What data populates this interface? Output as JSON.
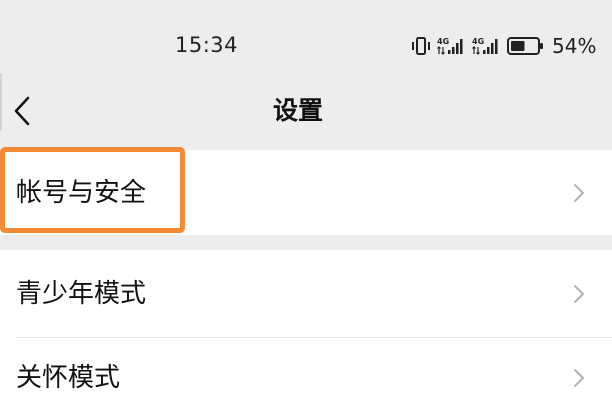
{
  "status_bar": {
    "time": "15:34",
    "network": [
      {
        "label": "4G"
      },
      {
        "label": "4G"
      }
    ],
    "battery": {
      "label": "54%",
      "level": 0.54
    }
  },
  "nav": {
    "title": "设置"
  },
  "settings": {
    "groups": [
      {
        "items": [
          {
            "label": "帐号与安全"
          }
        ]
      },
      {
        "items": [
          {
            "label": "青少年模式"
          },
          {
            "label": "关怀模式"
          }
        ]
      }
    ]
  },
  "icons": {
    "back": "chevron-left-icon",
    "row_arrow": "chevron-right-icon",
    "vibrate": "vibrate-icon",
    "signal": "signal-icon",
    "battery": "battery-icon"
  },
  "colors": {
    "background": "#ededed",
    "row": "#ffffff",
    "text": "#111111",
    "chevron": "#b3b3b3",
    "highlight": "#f28a36",
    "divider": "#e6e6e6",
    "status": "#222222"
  }
}
